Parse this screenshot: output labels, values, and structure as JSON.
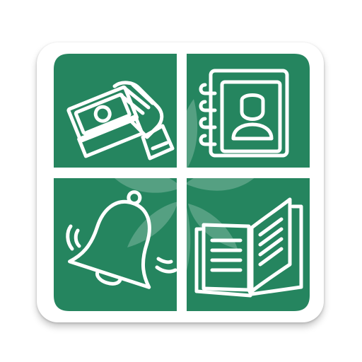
{
  "app_icon": {
    "background_color": "#ffffff",
    "tile_color": "#25855f",
    "line_color": "#ffffff",
    "watermark": "leaf-watermark",
    "tiles": [
      {
        "position": "top-left",
        "icon": "money-hand-icon"
      },
      {
        "position": "top-right",
        "icon": "contact-book-icon"
      },
      {
        "position": "bottom-left",
        "icon": "ringing-bell-icon"
      },
      {
        "position": "bottom-right",
        "icon": "open-book-icon"
      }
    ]
  }
}
